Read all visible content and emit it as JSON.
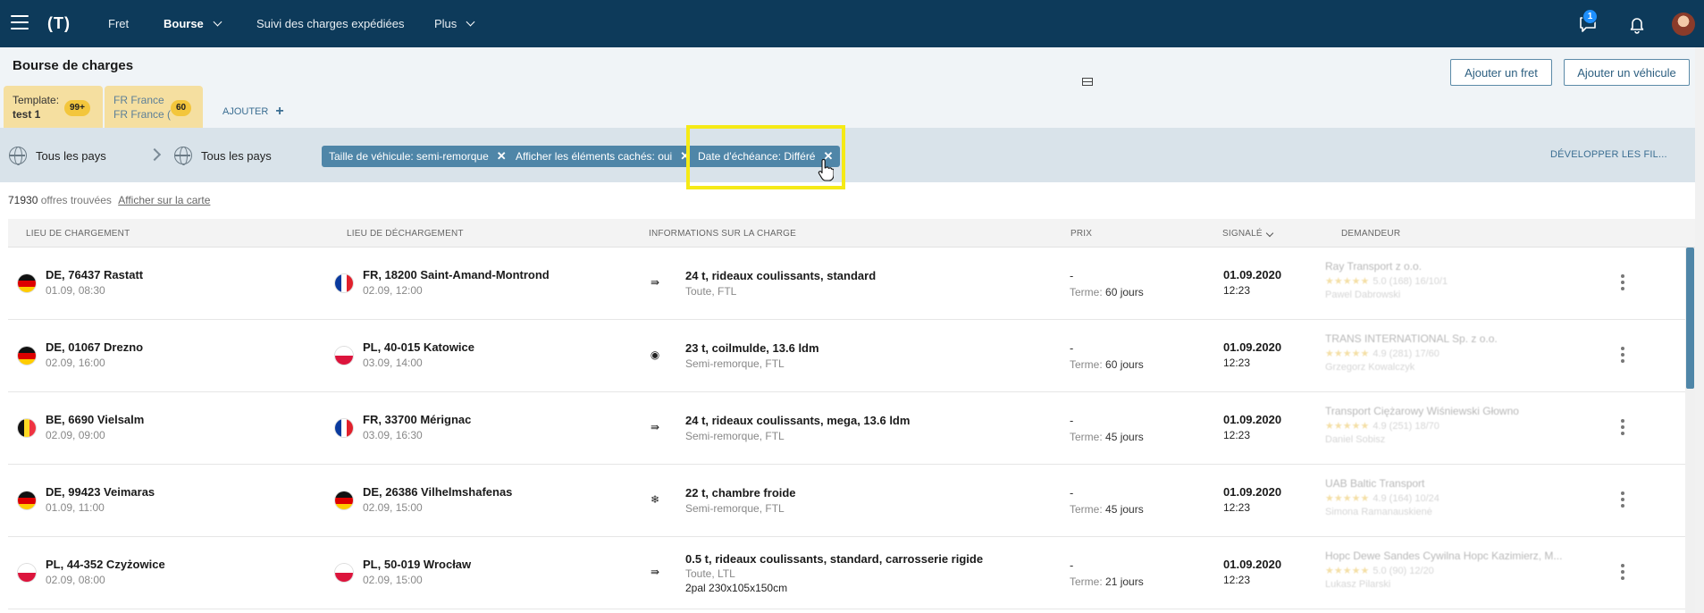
{
  "nav": {
    "logo": "(T)",
    "items": [
      {
        "label": "Fret"
      },
      {
        "label": "Bourse"
      },
      {
        "label": "Suivi des charges expédiées"
      },
      {
        "label": "Plus"
      }
    ],
    "message_badge": "1"
  },
  "header": {
    "title": "Bourse de charges",
    "tabs": [
      {
        "line1": "Template:",
        "line2": "test 1",
        "count": "99+"
      },
      {
        "line1": "FR France",
        "line2": "FR France (",
        "count": "60"
      }
    ],
    "add_label": "AJOUTER",
    "buttons": {
      "add_freight": "Ajouter un fret",
      "add_vehicle": "Ajouter un véhicule"
    }
  },
  "filters": {
    "from_country": "Tous les pays",
    "to_country": "Tous les pays",
    "chips": [
      "Taille de véhicule: semi-remorque",
      "Afficher les éléments cachés: oui",
      "Date d'échéance: Différé"
    ],
    "expand_label": "DÉVELOPPER LES FIL..."
  },
  "results": {
    "count": "71930",
    "count_label": "offres trouvées",
    "map_link": "Afficher sur la carte"
  },
  "table": {
    "headers": {
      "loading": "LIEU DE CHARGEMENT",
      "unloading": "LIEU DE DÉCHARGEMENT",
      "info": "INFORMATIONS SUR LA CHARGE",
      "price": "PRIX",
      "reported": "SIGNALÉ",
      "requester": "DEMANDEUR"
    },
    "term_label": "Terme:",
    "rows": [
      {
        "from_flag": "DE",
        "from": "DE, 76437 Rastatt",
        "from_date": "01.09, 08:30",
        "to_flag": "FR",
        "to": "FR, 18200 Saint-Amand-Montrond",
        "to_date": "02.09, 12:00",
        "cargo_icon": "curtain-icon",
        "cargo": "24 t, rideaux coulissants, standard",
        "cargo_sub": "Toute, FTL",
        "cargo_extra": "",
        "price": "-",
        "term": "60 jours",
        "date": "01.09.2020",
        "time": "12:23",
        "req_name": "Ray Transport z o.o.",
        "req_rating": "5.0 (168) 16/10/1",
        "req_contact": "Pawel Dabrowski"
      },
      {
        "from_flag": "DE",
        "from": "DE, 01067 Drezno",
        "from_date": "02.09, 16:00",
        "to_flag": "PL",
        "to": "PL, 40-015 Katowice",
        "to_date": "03.09, 14:00",
        "cargo_icon": "coil-icon",
        "cargo": "23 t, coilmulde, 13.6 ldm",
        "cargo_sub": "Semi-remorque, FTL",
        "cargo_extra": "",
        "price": "-",
        "term": "60 jours",
        "date": "01.09.2020",
        "time": "12:23",
        "req_name": "TRANS INTERNATIONAL Sp. z o.o.",
        "req_rating": "4.9 (281) 17/60",
        "req_contact": "Grzegorz Kowalczyk"
      },
      {
        "from_flag": "BE",
        "from": "BE, 6690 Vielsalm",
        "from_date": "02.09, 09:00",
        "to_flag": "FR",
        "to": "FR, 33700 Mérignac",
        "to_date": "03.09, 16:30",
        "cargo_icon": "curtain-icon",
        "cargo": "24 t, rideaux coulissants, mega, 13.6 ldm",
        "cargo_sub": "Semi-remorque, FTL",
        "cargo_extra": "",
        "price": "-",
        "term": "45 jours",
        "date": "01.09.2020",
        "time": "12:23",
        "req_name": "Transport Ciężarowy Wiśniewski Głowno",
        "req_rating": "4.9 (251) 18/70",
        "req_contact": "Daniel Sobisz"
      },
      {
        "from_flag": "DE",
        "from": "DE, 99423 Veimaras",
        "from_date": "01.09, 11:00",
        "to_flag": "DE",
        "to": "DE, 26386 Vilhelmshafenas",
        "to_date": "02.09, 15:00",
        "cargo_icon": "snowflake-icon",
        "cargo": "22 t, chambre froide",
        "cargo_sub": "Semi-remorque, FTL",
        "cargo_extra": "",
        "price": "-",
        "term": "45 jours",
        "date": "01.09.2020",
        "time": "12:23",
        "req_name": "UAB Baltic Transport",
        "req_rating": "4.9 (164) 10/24",
        "req_contact": "Simona Ramanauskienė"
      },
      {
        "from_flag": "PL",
        "from": "PL, 44-352 Czyżowice",
        "from_date": "02.09, 08:00",
        "to_flag": "PL",
        "to": "PL, 50-019 Wrocław",
        "to_date": "02.09, 15:00",
        "cargo_icon": "curtain-icon",
        "cargo": "0.5 t, rideaux coulissants, standard, carrosserie rigide",
        "cargo_sub": "Toute, LTL",
        "cargo_extra": "2pal 230x105x150cm",
        "price": "-",
        "term": "21 jours",
        "date": "01.09.2020",
        "time": "12:23",
        "req_name": "Hopc Dewe Sandes Cywilna Hopc Kazimierz, M...",
        "req_rating": "5.0 (90) 12/20",
        "req_contact": "Lukasz Pilarski"
      }
    ]
  },
  "colors": {
    "nav_bg": "#0d3a5a",
    "chip_bg": "#4f86a8",
    "tab_bg": "#f5dfa0",
    "highlight": "#f5ea16"
  }
}
